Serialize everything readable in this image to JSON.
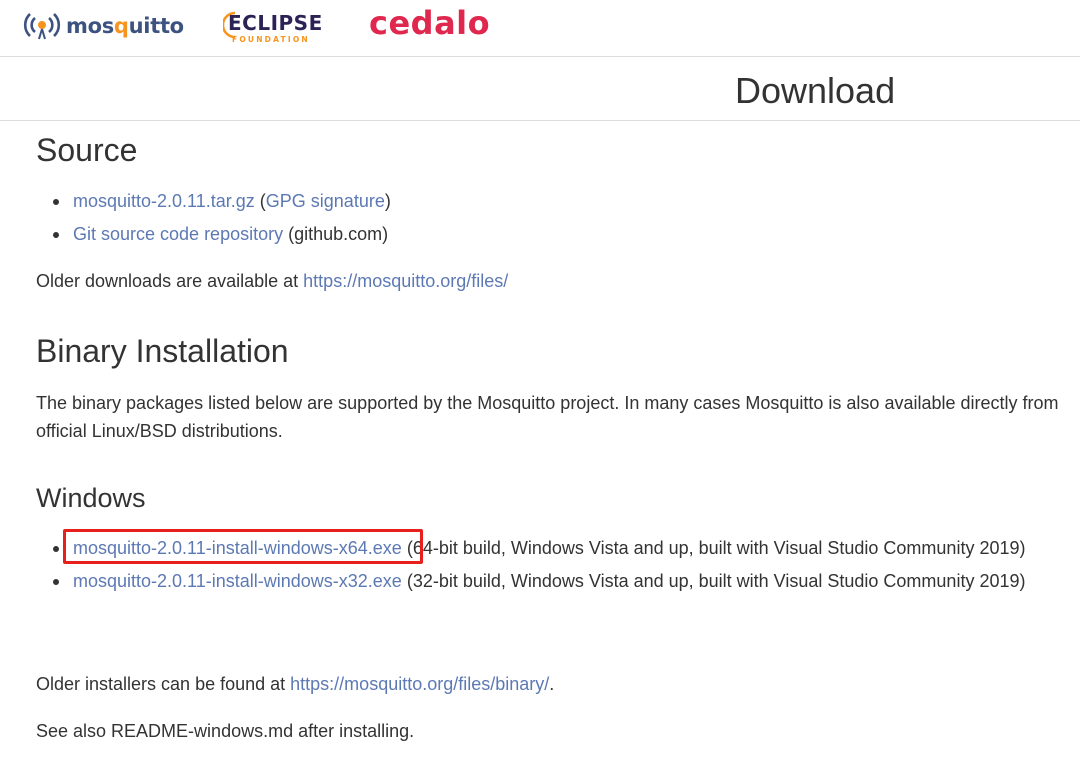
{
  "header": {
    "logos": [
      {
        "name": "mosquitto",
        "text_a": "mos",
        "text_q": "q",
        "text_b": "uitto",
        "icon": "broadcast-wave-icon"
      },
      {
        "name": "eclipse",
        "text": "ECLIPSE",
        "subtext": "FOUNDATION"
      },
      {
        "name": "cedalo",
        "text": "cedalo"
      }
    ],
    "colors": {
      "mosquitto": "#3c5280",
      "mosquitto_accent": "#f5941e",
      "eclipse": "#2c2255",
      "eclipse_accent": "#f7941e",
      "cedalo": "#e0284f"
    }
  },
  "page_title": "Download",
  "source": {
    "heading": "Source",
    "items": [
      {
        "link": "mosquitto-2.0.11.tar.gz",
        "pre": " (",
        "link2": "GPG signature",
        "post": ")"
      },
      {
        "link": "Git source code repository",
        "post": " (github.com)"
      }
    ],
    "older_text": "Older downloads are available at ",
    "older_link": "https://mosquitto.org/files/"
  },
  "binary": {
    "heading": "Binary Installation",
    "description": "The binary packages listed below are supported by the Mosquitto project. In many cases Mosquitto is also available directly from official Linux/BSD distributions."
  },
  "windows": {
    "heading": "Windows",
    "items": [
      {
        "link": "mosquitto-2.0.11-install-windows-x64.exe",
        "post": " (64-bit build, Windows Vista and up, built with Visual Studio Community 2019)"
      },
      {
        "link": "mosquitto-2.0.11-install-windows-x32.exe",
        "post": " (32-bit build, Windows Vista and up, built with Visual Studio Community 2019)"
      }
    ],
    "older_text": "Older installers can be found at ",
    "older_link": "https://mosquitto.org/files/binary/",
    "older_post": ".",
    "see_also": "See also README-windows.md after installing."
  },
  "annotation": {
    "highlight_color": "#e8201c"
  },
  "link_color": "#5c79b3"
}
